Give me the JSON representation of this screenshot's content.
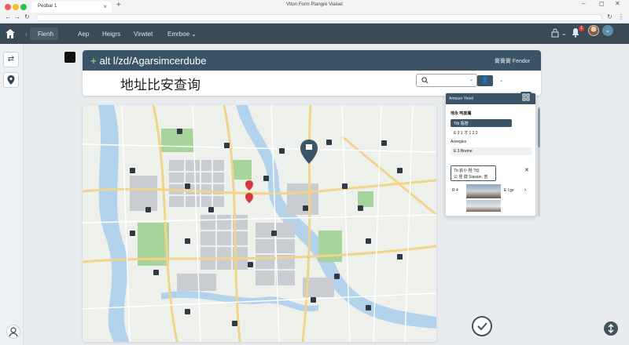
{
  "browser": {
    "tab_title": "Pedbar 1",
    "tab_close": "×",
    "new_tab": "+",
    "window_title": "Vtton Form Ptangre Viaiset",
    "min": "–",
    "max": "◻",
    "close": "✕",
    "back": "←",
    "forward": "→",
    "reload": "↻"
  },
  "nav": {
    "items": [
      {
        "label": "Fienh"
      },
      {
        "label": "Aep"
      },
      {
        "label": "Heigrs"
      },
      {
        "label": "Virwtet"
      },
      {
        "label": "Emrboe ⌄"
      }
    ],
    "notification_count": "1",
    "lock_caret": "⌄"
  },
  "header": {
    "title": "alt l/zd/Agarsimcerdube",
    "plus": "+",
    "right_label": "膏膏膏 Fendor",
    "page_title": "地址比安查询",
    "search_placeholder": "",
    "search_caret": "⌄",
    "user_btn": "👤",
    "user_caret": "⌄"
  },
  "panel": {
    "header": "Amouer Yeoel",
    "section1": "地永 咤度鹰",
    "row1": "Ttb 瓶赔",
    "row2": "E 2 1 才 1  2 3",
    "section2": "Avvegles",
    "row3": "E 3 Breme",
    "card_line1": "Tb 荻小 羟 ?谂",
    "card_line2": "公 荏 徵 Siasain, 苦",
    "card_close": "✕",
    "item_text_left": "R 4",
    "item_text_right": "E l ge",
    "item_caret": "›"
  },
  "colors": {
    "primary": "#3c5566",
    "nav_bg": "#3a4a57",
    "badge": "#e53935",
    "map_road_main": "#f1d48a",
    "map_water": "#a9cbe8",
    "map_park": "#9dcf8f",
    "marker": "#2f3b44",
    "marker_red": "#d63a3a"
  },
  "icons": {
    "home": "home-icon",
    "search": "search-icon",
    "location_pin": "map-pin-icon",
    "check": "check-icon",
    "grid": "grid-icon"
  }
}
